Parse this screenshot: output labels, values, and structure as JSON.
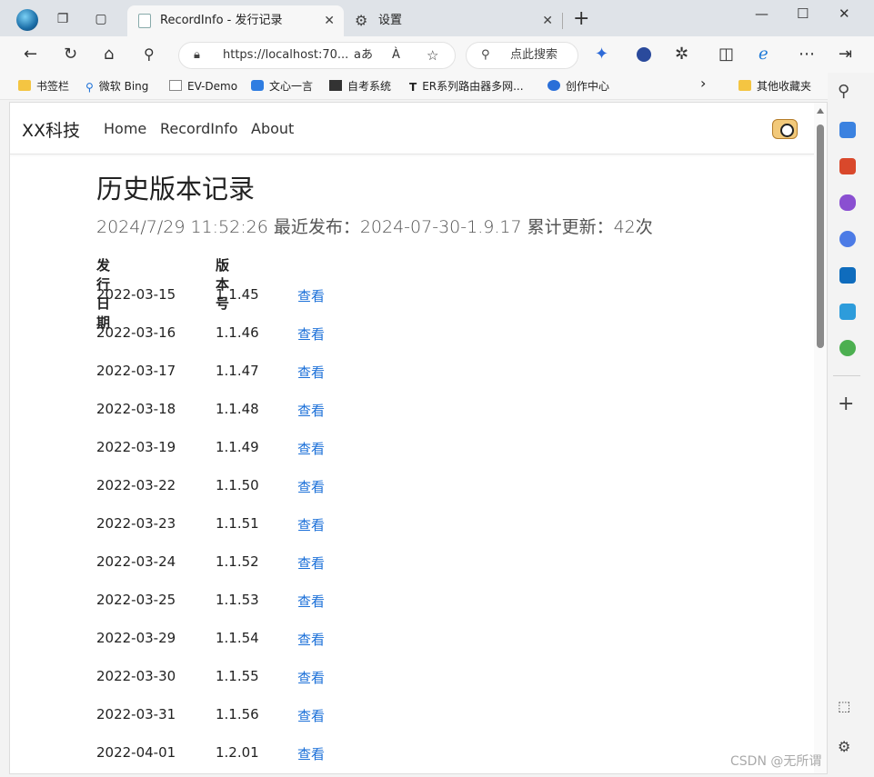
{
  "tabs": [
    {
      "title": "RecordInfo - 发行记录",
      "active": true
    },
    {
      "title": "设置",
      "active": false
    }
  ],
  "address": {
    "url": "https://localhost:70...",
    "read_aloud_label": "aあ",
    "immersive_label": "À",
    "search_placeholder": "点此搜索"
  },
  "bookmarks": [
    {
      "label": "书签栏",
      "icon": "folder-icon"
    },
    {
      "label": "微软 Bing",
      "icon": "search-icon"
    },
    {
      "label": "EV-Demo",
      "icon": "page-icon"
    },
    {
      "label": "文心一言",
      "icon": "logo-icon"
    },
    {
      "label": "自考系统",
      "icon": "app-icon"
    },
    {
      "label": "ER系列路由器多网...",
      "icon": "router-icon"
    },
    {
      "label": "创作中心",
      "icon": "paw-icon"
    },
    {
      "label": "其他收藏夹",
      "icon": "folder-icon"
    }
  ],
  "site": {
    "brand": "XX科技",
    "nav": [
      "Home",
      "RecordInfo",
      "About"
    ]
  },
  "page": {
    "title": "历史版本记录",
    "subtitle": "2024/7/29 11:52:26 最近发布：2024-07-30-1.9.17 累计更新：42次",
    "headers": [
      "发行日期",
      "版本号"
    ],
    "view_label": "查看",
    "rows": [
      {
        "date": "2022-03-15",
        "version": "1.1.45"
      },
      {
        "date": "2022-03-16",
        "version": "1.1.46"
      },
      {
        "date": "2022-03-17",
        "version": "1.1.47"
      },
      {
        "date": "2022-03-18",
        "version": "1.1.48"
      },
      {
        "date": "2022-03-19",
        "version": "1.1.49"
      },
      {
        "date": "2022-03-22",
        "version": "1.1.50"
      },
      {
        "date": "2022-03-23",
        "version": "1.1.51"
      },
      {
        "date": "2022-03-24",
        "version": "1.1.52"
      },
      {
        "date": "2022-03-25",
        "version": "1.1.53"
      },
      {
        "date": "2022-03-29",
        "version": "1.1.54"
      },
      {
        "date": "2022-03-30",
        "version": "1.1.55"
      },
      {
        "date": "2022-03-31",
        "version": "1.1.56"
      },
      {
        "date": "2022-04-01",
        "version": "1.2.01"
      }
    ]
  },
  "watermark": "CSDN @无所谓",
  "colors": {
    "link": "#1a6fd8",
    "tab_active": "#f7f7f7"
  }
}
